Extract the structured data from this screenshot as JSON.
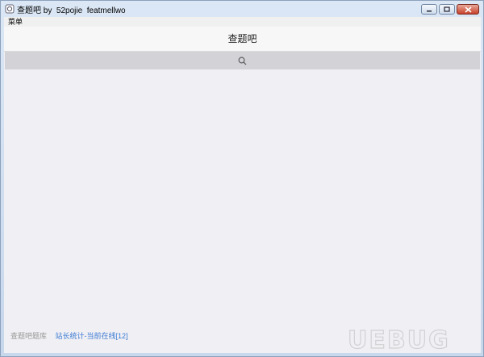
{
  "window": {
    "title": "查题吧 by  52pojie  featmellwo"
  },
  "menubar": {
    "items": [
      {
        "label": "菜单"
      }
    ]
  },
  "header": {
    "title": "查题吧"
  },
  "search": {
    "icon": "search-icon"
  },
  "footer": {
    "label": "查题吧题库",
    "link": "站长统计-当前在线[12]"
  },
  "watermark": {
    "text": "UEBUG"
  },
  "colors": {
    "client_bg": "#f0eff4",
    "search_bg": "#d2d2d7",
    "link": "#3a7ad2",
    "close_button": "#c7412b"
  }
}
